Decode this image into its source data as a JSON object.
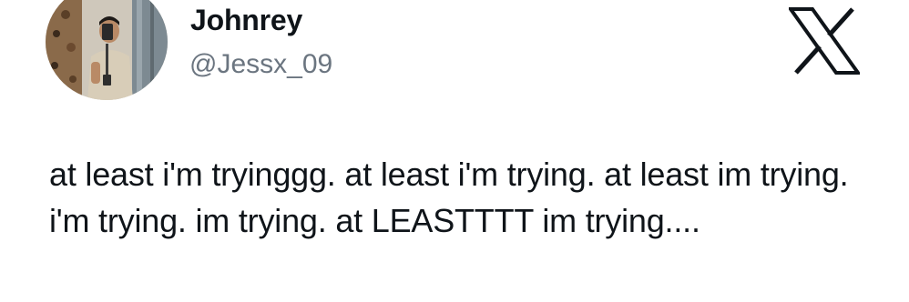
{
  "tweet": {
    "author": {
      "display_name": "Johnrey",
      "handle": "@Jessx_09",
      "avatar": "profile-photo"
    },
    "brand_icon": "x-logo-icon",
    "text": "at least i'm tryinggg. at least i'm trying. at least im trying. i'm trying. im trying. at LEASTTTT im trying....",
    "colors": {
      "background": "#ffffff",
      "text": "#0f1419",
      "handle": "#6b7580"
    }
  }
}
